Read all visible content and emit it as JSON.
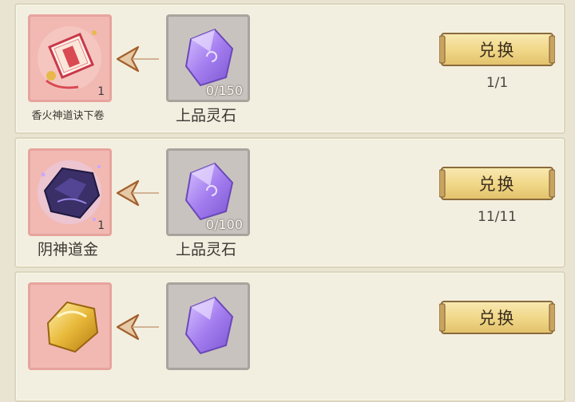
{
  "rows": [
    {
      "reward": {
        "name": "香火神道诀下卷",
        "quantity": "1",
        "icon": "scroll-book-icon"
      },
      "cost": {
        "name": "上品灵石",
        "amount": "0/150",
        "icon": "purple-spirit-stone-icon"
      },
      "exchange_label": "兑换",
      "exchange_count": "1/1"
    },
    {
      "reward": {
        "name": "阴神道金",
        "quantity": "1",
        "icon": "dark-ore-icon"
      },
      "cost": {
        "name": "上品灵石",
        "amount": "0/100",
        "icon": "purple-spirit-stone-icon"
      },
      "exchange_label": "兑换",
      "exchange_count": "11/11"
    },
    {
      "reward": {
        "name": "",
        "quantity": "",
        "icon": "gold-ore-icon"
      },
      "cost": {
        "name": "",
        "amount": "",
        "icon": "purple-spirit-stone-icon"
      },
      "exchange_label": "兑换",
      "exchange_count": ""
    }
  ],
  "colors": {
    "reward_bg": "#f0b6b0",
    "cost_bg": "#c9c3bf",
    "button_gold": "#f1d88a",
    "panel": "#f3efe0"
  }
}
